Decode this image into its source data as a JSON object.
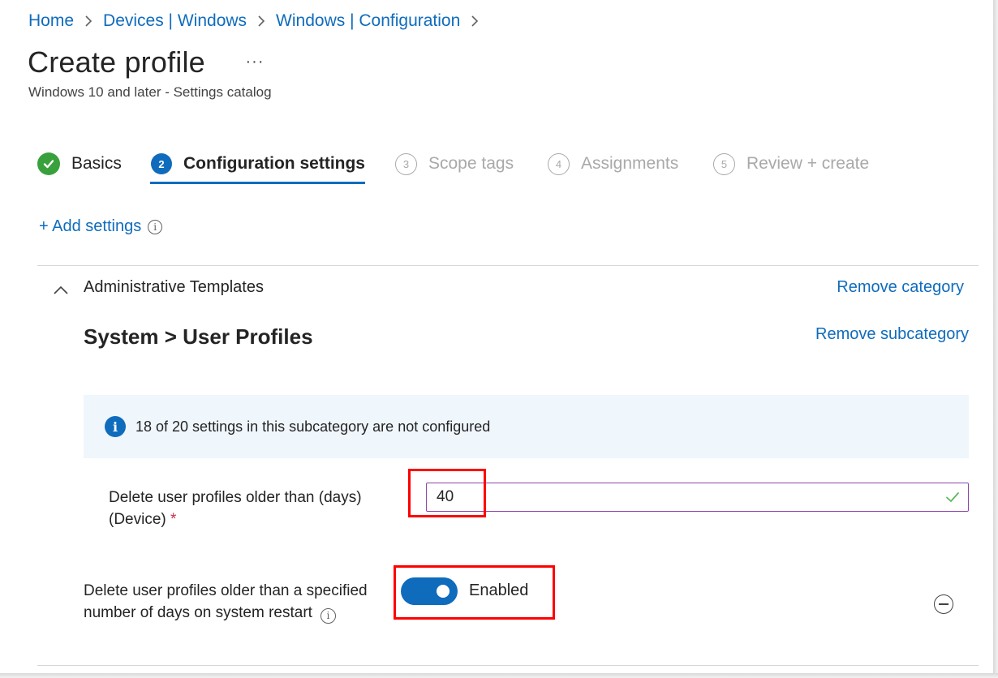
{
  "breadcrumb": [
    {
      "label": "Home"
    },
    {
      "label": "Devices | Windows"
    },
    {
      "label": "Windows | Configuration"
    }
  ],
  "header": {
    "title": "Create profile",
    "more_label": "···",
    "subtitle": "Windows 10 and later - Settings catalog"
  },
  "wizard": {
    "steps": [
      {
        "number": "",
        "label": "Basics",
        "state": "completed"
      },
      {
        "number": "2",
        "label": "Configuration settings",
        "state": "current"
      },
      {
        "number": "3",
        "label": "Scope tags",
        "state": "upcoming"
      },
      {
        "number": "4",
        "label": "Assignments",
        "state": "upcoming"
      },
      {
        "number": "5",
        "label": "Review + create",
        "state": "upcoming"
      }
    ]
  },
  "add_settings": {
    "label": "+ Add settings",
    "info_glyph": "i"
  },
  "category": {
    "title": "Administrative Templates",
    "remove_label": "Remove category",
    "subcategory_title": "System > User Profiles",
    "remove_sub_label": "Remove subcategory"
  },
  "info_banner": {
    "glyph": "i",
    "text": "18 of 20 settings in this subcategory are not configured"
  },
  "settings": {
    "days_field": {
      "label": "Delete user profiles older than (days) (Device)",
      "required_mark": "*",
      "value": "40"
    },
    "restart_toggle": {
      "label": "Delete user profiles older than a specified number of days on system restart",
      "info_glyph": "i",
      "state_label": "Enabled",
      "enabled": true
    }
  },
  "colors": {
    "accent": "#0f6cbd",
    "success": "#38a13b",
    "highlight": "#ff0000",
    "input_border": "#8e44ad"
  }
}
